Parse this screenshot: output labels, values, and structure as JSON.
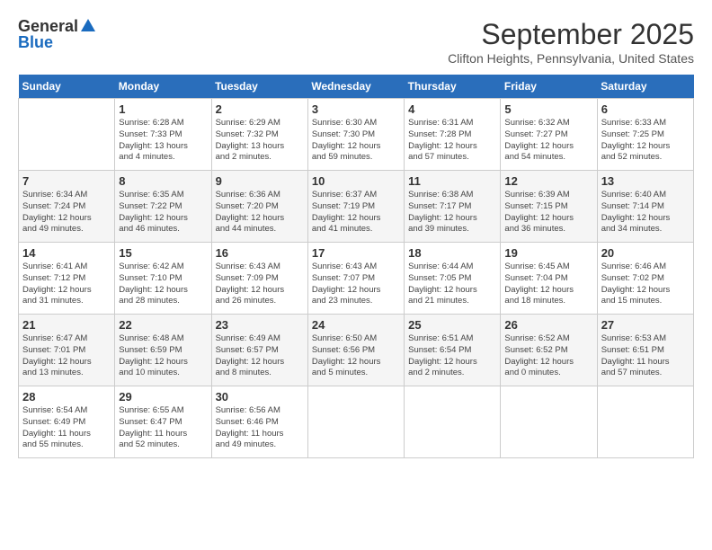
{
  "logo": {
    "general": "General",
    "blue": "Blue"
  },
  "title": "September 2025",
  "location": "Clifton Heights, Pennsylvania, United States",
  "days_of_week": [
    "Sunday",
    "Monday",
    "Tuesday",
    "Wednesday",
    "Thursday",
    "Friday",
    "Saturday"
  ],
  "weeks": [
    [
      {
        "day": "",
        "info": ""
      },
      {
        "day": "1",
        "info": "Sunrise: 6:28 AM\nSunset: 7:33 PM\nDaylight: 13 hours\nand 4 minutes."
      },
      {
        "day": "2",
        "info": "Sunrise: 6:29 AM\nSunset: 7:32 PM\nDaylight: 13 hours\nand 2 minutes."
      },
      {
        "day": "3",
        "info": "Sunrise: 6:30 AM\nSunset: 7:30 PM\nDaylight: 12 hours\nand 59 minutes."
      },
      {
        "day": "4",
        "info": "Sunrise: 6:31 AM\nSunset: 7:28 PM\nDaylight: 12 hours\nand 57 minutes."
      },
      {
        "day": "5",
        "info": "Sunrise: 6:32 AM\nSunset: 7:27 PM\nDaylight: 12 hours\nand 54 minutes."
      },
      {
        "day": "6",
        "info": "Sunrise: 6:33 AM\nSunset: 7:25 PM\nDaylight: 12 hours\nand 52 minutes."
      }
    ],
    [
      {
        "day": "7",
        "info": "Sunrise: 6:34 AM\nSunset: 7:24 PM\nDaylight: 12 hours\nand 49 minutes."
      },
      {
        "day": "8",
        "info": "Sunrise: 6:35 AM\nSunset: 7:22 PM\nDaylight: 12 hours\nand 46 minutes."
      },
      {
        "day": "9",
        "info": "Sunrise: 6:36 AM\nSunset: 7:20 PM\nDaylight: 12 hours\nand 44 minutes."
      },
      {
        "day": "10",
        "info": "Sunrise: 6:37 AM\nSunset: 7:19 PM\nDaylight: 12 hours\nand 41 minutes."
      },
      {
        "day": "11",
        "info": "Sunrise: 6:38 AM\nSunset: 7:17 PM\nDaylight: 12 hours\nand 39 minutes."
      },
      {
        "day": "12",
        "info": "Sunrise: 6:39 AM\nSunset: 7:15 PM\nDaylight: 12 hours\nand 36 minutes."
      },
      {
        "day": "13",
        "info": "Sunrise: 6:40 AM\nSunset: 7:14 PM\nDaylight: 12 hours\nand 34 minutes."
      }
    ],
    [
      {
        "day": "14",
        "info": "Sunrise: 6:41 AM\nSunset: 7:12 PM\nDaylight: 12 hours\nand 31 minutes."
      },
      {
        "day": "15",
        "info": "Sunrise: 6:42 AM\nSunset: 7:10 PM\nDaylight: 12 hours\nand 28 minutes."
      },
      {
        "day": "16",
        "info": "Sunrise: 6:43 AM\nSunset: 7:09 PM\nDaylight: 12 hours\nand 26 minutes."
      },
      {
        "day": "17",
        "info": "Sunrise: 6:43 AM\nSunset: 7:07 PM\nDaylight: 12 hours\nand 23 minutes."
      },
      {
        "day": "18",
        "info": "Sunrise: 6:44 AM\nSunset: 7:05 PM\nDaylight: 12 hours\nand 21 minutes."
      },
      {
        "day": "19",
        "info": "Sunrise: 6:45 AM\nSunset: 7:04 PM\nDaylight: 12 hours\nand 18 minutes."
      },
      {
        "day": "20",
        "info": "Sunrise: 6:46 AM\nSunset: 7:02 PM\nDaylight: 12 hours\nand 15 minutes."
      }
    ],
    [
      {
        "day": "21",
        "info": "Sunrise: 6:47 AM\nSunset: 7:01 PM\nDaylight: 12 hours\nand 13 minutes."
      },
      {
        "day": "22",
        "info": "Sunrise: 6:48 AM\nSunset: 6:59 PM\nDaylight: 12 hours\nand 10 minutes."
      },
      {
        "day": "23",
        "info": "Sunrise: 6:49 AM\nSunset: 6:57 PM\nDaylight: 12 hours\nand 8 minutes."
      },
      {
        "day": "24",
        "info": "Sunrise: 6:50 AM\nSunset: 6:56 PM\nDaylight: 12 hours\nand 5 minutes."
      },
      {
        "day": "25",
        "info": "Sunrise: 6:51 AM\nSunset: 6:54 PM\nDaylight: 12 hours\nand 2 minutes."
      },
      {
        "day": "26",
        "info": "Sunrise: 6:52 AM\nSunset: 6:52 PM\nDaylight: 12 hours\nand 0 minutes."
      },
      {
        "day": "27",
        "info": "Sunrise: 6:53 AM\nSunset: 6:51 PM\nDaylight: 11 hours\nand 57 minutes."
      }
    ],
    [
      {
        "day": "28",
        "info": "Sunrise: 6:54 AM\nSunset: 6:49 PM\nDaylight: 11 hours\nand 55 minutes."
      },
      {
        "day": "29",
        "info": "Sunrise: 6:55 AM\nSunset: 6:47 PM\nDaylight: 11 hours\nand 52 minutes."
      },
      {
        "day": "30",
        "info": "Sunrise: 6:56 AM\nSunset: 6:46 PM\nDaylight: 11 hours\nand 49 minutes."
      },
      {
        "day": "",
        "info": ""
      },
      {
        "day": "",
        "info": ""
      },
      {
        "day": "",
        "info": ""
      },
      {
        "day": "",
        "info": ""
      }
    ]
  ]
}
